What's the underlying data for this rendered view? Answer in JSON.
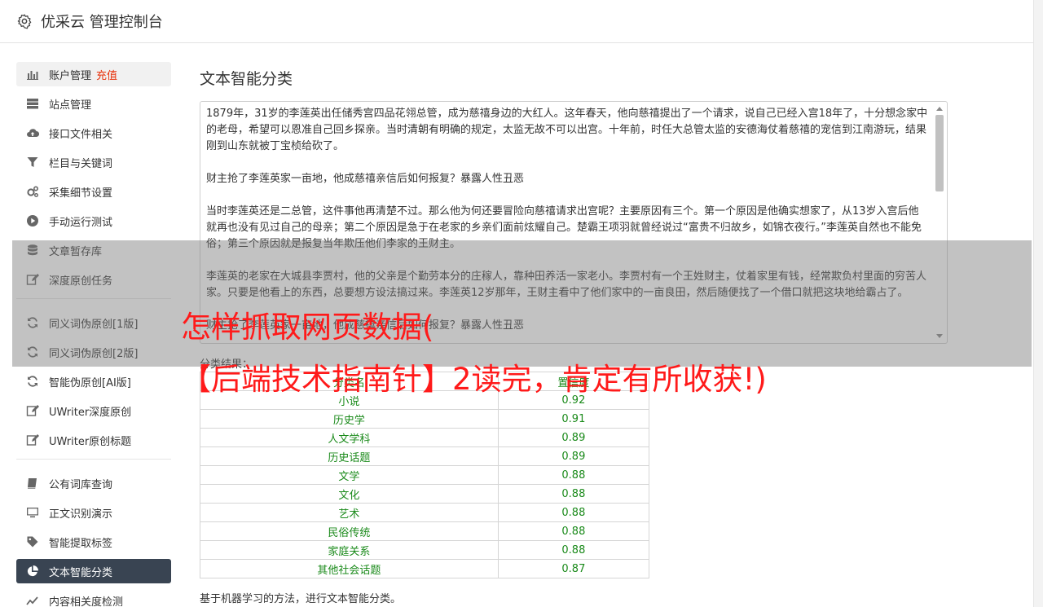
{
  "header": {
    "title": "优采云 管理控制台",
    "icon": "gear-icon"
  },
  "sidebar": {
    "groups": [
      [
        {
          "label": "账户管理",
          "badge": "充值",
          "icon": "bar-chart-icon"
        },
        {
          "label": "站点管理",
          "icon": "server-icon"
        },
        {
          "label": "接口文件相关",
          "icon": "cloud-upload-icon"
        },
        {
          "label": "栏目与关键词",
          "icon": "filter-icon"
        },
        {
          "label": "采集细节设置",
          "icon": "cogs-icon"
        },
        {
          "label": "手动运行测试",
          "icon": "play-circle-icon"
        },
        {
          "label": "文章暂存库",
          "icon": "database-icon"
        },
        {
          "label": "深度原创任务",
          "icon": "edit-icon"
        }
      ],
      [
        {
          "label": "同义词伪原创[1版]",
          "icon": "refresh-icon"
        },
        {
          "label": "同义词伪原创[2版]",
          "icon": "refresh-icon"
        },
        {
          "label": "智能伪原创[AI版]",
          "icon": "refresh-icon"
        },
        {
          "label": "UWriter深度原创",
          "icon": "edit-icon"
        },
        {
          "label": "UWriter原创标题",
          "icon": "edit-icon"
        }
      ],
      [
        {
          "label": "公有词库查询",
          "icon": "book-icon"
        },
        {
          "label": "正文识别演示",
          "icon": "monitor-icon"
        },
        {
          "label": "智能提取标签",
          "icon": "tag-icon"
        },
        {
          "label": "文本智能分类",
          "icon": "pie-chart-icon"
        },
        {
          "label": "内容相关度检测",
          "icon": "chart-icon"
        }
      ]
    ]
  },
  "main": {
    "title": "文本智能分类",
    "text_paragraphs": [
      "1879年，31岁的李莲英出任储秀宫四品花翎总管，成为慈禧身边的大红人。这年春天，他向慈禧提出了一个请求，说自己已经入宫18年了，十分想念家中的老母，希望可以恩准自己回乡探亲。当时清朝有明确的规定，太监无故不可以出宫。十年前，时任大总管太监的安德海仗着慈禧的宠信到江南游玩，结果刚到山东就被丁宝桢给砍了。",
      "财主抢了李莲英家一亩地，他成慈禧亲信后如何报复？暴露人性丑恶",
      "当时李莲英还是二总管，这件事他再清楚不过。那么他为何还要冒险向慈禧请求出宫呢？主要原因有三个。第一个原因是他确实想家了，从13岁入宫后他就再也没有见过自己的母亲；第二个原因是急于在老家的乡亲们面前炫耀自己。楚霸王项羽就曾经说过“富贵不归故乡，如锦衣夜行。”李莲英自然也不能免俗；第三个原因就是报复当年欺压他们李家的王财主。",
      "李莲英的老家在大城县李贾村，他的父亲是个勤劳本分的庄稼人，靠种田养活一家老小。李贾村有一个王姓财主，仗着家里有钱，经常欺负村里面的穷苦人家。只要是他看上的东西，总要想方设法搞过来。李莲英12岁那年，王财主看中了他们家中的一亩良田，然后随便找了一个借口就把这块地给霸占了。",
      "财主抢了李莲英家一亩地，他成慈禧亲信后如何报复？暴露人性丑恶"
    ],
    "result_label": "分类结果：",
    "table": {
      "headers": [
        "分类名",
        "置信度"
      ],
      "rows": [
        [
          "小说",
          "0.92"
        ],
        [
          "历史学",
          "0.91"
        ],
        [
          "人文学科",
          "0.89"
        ],
        [
          "历史话题",
          "0.89"
        ],
        [
          "文学",
          "0.88"
        ],
        [
          "文化",
          "0.88"
        ],
        [
          "艺术",
          "0.88"
        ],
        [
          "民俗传统",
          "0.88"
        ],
        [
          "家庭关系",
          "0.88"
        ],
        [
          "其他社会话题",
          "0.87"
        ]
      ]
    },
    "footnote": "基于机器学习的方法，进行文本智能分类。"
  },
  "overlay": {
    "line1": "怎样抓取网页数据(",
    "line2": "【后端技术指南针】2读完，肯定有所收获!)"
  },
  "colors": {
    "accent_red": "#e8310b",
    "table_text": "#1a8a1a",
    "active_nav": "#394452",
    "overlay_text": "#ff1a1a"
  }
}
